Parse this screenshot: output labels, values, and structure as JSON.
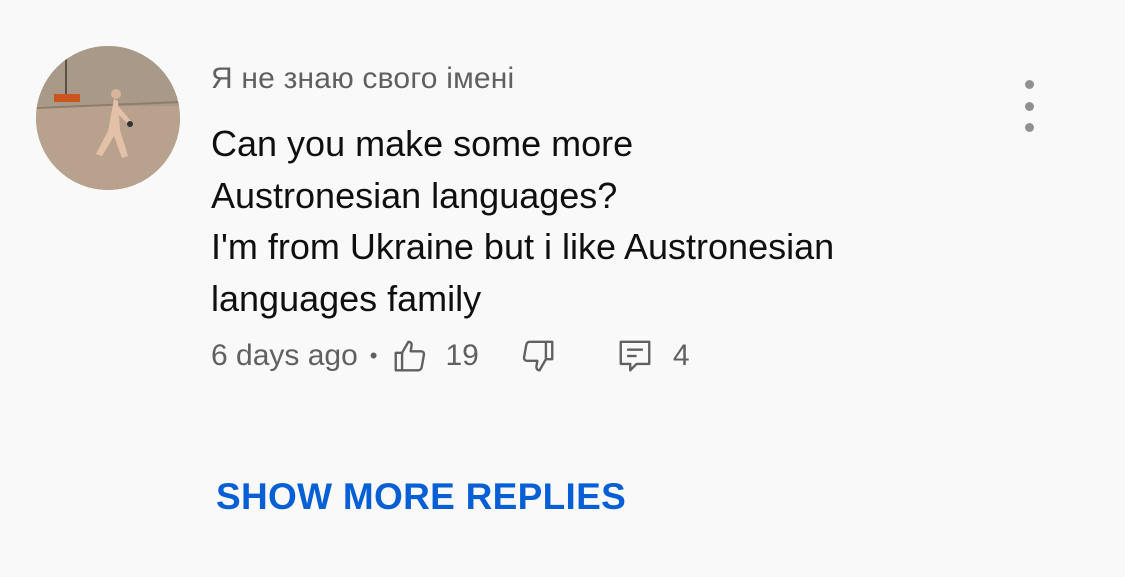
{
  "comment": {
    "author": "Я не знаю свого імені",
    "text": "Can you make some more\nAustronesian languages?\nI'm from Ukraine but i like Austronesian\nlanguages family",
    "timestamp": "6 days ago",
    "separator": "•",
    "likes": "19",
    "replies": "4",
    "icons": {
      "avatar": "avatar-image",
      "more": "more-vert-icon",
      "like": "thumbs-up-icon",
      "dislike": "thumbs-down-icon",
      "reply": "comment-icon"
    }
  },
  "actions": {
    "show_more_replies": "SHOW MORE REPLIES"
  },
  "colors": {
    "background": "#f9f9f9",
    "text": "#0f0f0f",
    "secondary": "#606060",
    "link": "#065fd4"
  }
}
